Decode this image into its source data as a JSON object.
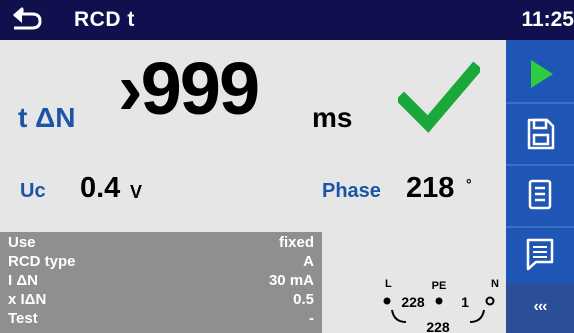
{
  "header": {
    "title": "RCD t",
    "time": "11:25",
    "back_icon": "back-arrow-icon"
  },
  "result": {
    "label": "t ΔN",
    "value": "›999",
    "unit": "ms",
    "status_icon": "checkmark-icon",
    "status_color": "#1aa83a"
  },
  "measurements": {
    "uc_label": "Uc",
    "uc_value": "0.4",
    "uc_unit": "V",
    "phase_label": "Phase",
    "phase_value": "218",
    "phase_unit": "°"
  },
  "parameters": [
    {
      "name": "Use",
      "value": "fixed"
    },
    {
      "name": "RCD type",
      "value": "A"
    },
    {
      "name": "I ΔN",
      "value": "30 mA"
    },
    {
      "name": "x IΔN",
      "value": "0.5"
    },
    {
      "name": "Test",
      "value": "-"
    }
  ],
  "diagram": {
    "terminal_l": "L",
    "terminal_pe": "PE",
    "terminal_n": "N",
    "voltage_l_pe": "228",
    "voltage_pe_n": "1",
    "voltage_l_n": "228"
  },
  "sidebar": {
    "buttons": [
      "play-icon",
      "save-icon",
      "list-icon",
      "comment-icon"
    ],
    "more_label": "‹‹‹"
  },
  "colors": {
    "header_bg": "#10104f",
    "sidebar_bg": "#1f56b5",
    "label_blue": "#1a56a8",
    "params_bg": "#8f8f8f",
    "play_green": "#2ecc40"
  }
}
